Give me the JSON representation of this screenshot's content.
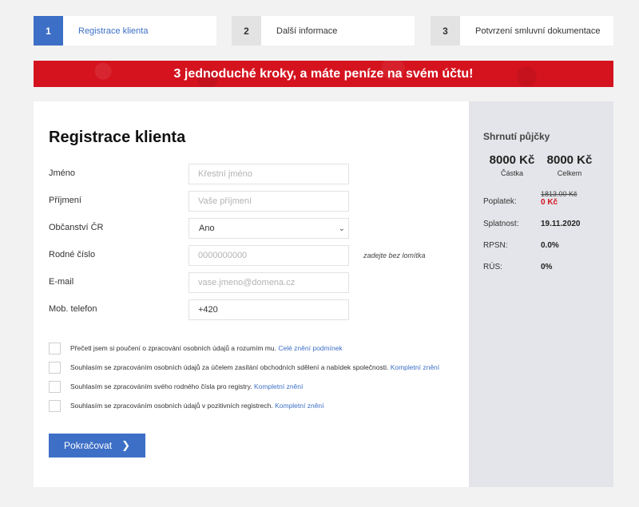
{
  "steps": [
    {
      "number": "1",
      "label": "Registrace klienta"
    },
    {
      "number": "2",
      "label": "Další informace"
    },
    {
      "number": "3",
      "label": "Potvrzení smluvní dokumentace"
    }
  ],
  "banner": "3 jednoduché kroky, a máte peníze na svém účtu!",
  "form": {
    "title": "Registrace klienta",
    "first_name": {
      "label": "Jméno",
      "placeholder": "Křestní jméno"
    },
    "last_name": {
      "label": "Příjmení",
      "placeholder": "Vaše příjmení"
    },
    "citizenship": {
      "label": "Občanství ČR",
      "value": "Ano"
    },
    "birth_number": {
      "label": "Rodné číslo",
      "placeholder": "0000000000",
      "hint": "zadejte bez lomítka"
    },
    "email": {
      "label": "E-mail",
      "placeholder": "vase.jmeno@domena.cz"
    },
    "phone": {
      "label": "Mob. telefon",
      "value": "+420"
    }
  },
  "consents": [
    {
      "text": "Přečetl jsem si poučení o zpracování osobních údajů a rozumím mu.",
      "link": "Celé znění podmínek"
    },
    {
      "text": "Souhlasím se zpracováním osobních údajů za účelem zasílání obchodních sdělení a nabídek společnosti.",
      "link": "Kompletní znění"
    },
    {
      "text": "Souhlasím se zpracováním svého rodného čísla pro registry.",
      "link": "Kompletní znění"
    },
    {
      "text": "Souhlasím se zpracováním osobních údajů v pozitivních registrech.",
      "link": "Kompletní znění"
    }
  ],
  "continue_label": "Pokračovat",
  "summary": {
    "title": "Shrnutí půjčky",
    "amount": {
      "value": "8000 Kč",
      "caption": "Částka"
    },
    "total": {
      "value": "8000 Kč",
      "caption": "Celkem"
    },
    "fee": {
      "label": "Poplatek:",
      "old": "1813.00 Kč",
      "new": "0 Kč"
    },
    "due": {
      "label": "Splatnost:",
      "value": "19.11.2020"
    },
    "rpsn": {
      "label": "RPSN:",
      "value": "0.0%"
    },
    "rus": {
      "label": "RÚS:",
      "value": "0%"
    }
  },
  "colors": {
    "accent": "#3d6fc6",
    "banner": "#d4131f",
    "summary_bg": "#e4e5ea"
  }
}
